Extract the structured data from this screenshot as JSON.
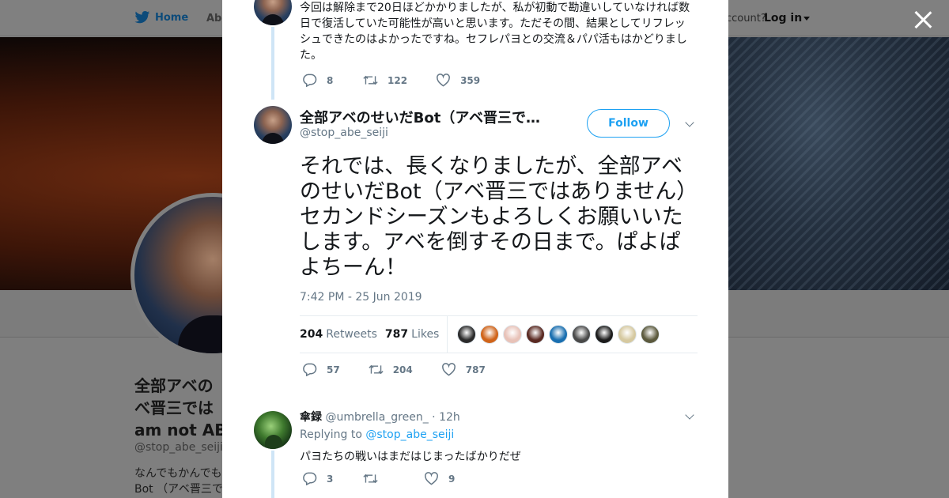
{
  "nav": {
    "home_label": "Home",
    "profile_label_partial": "Abe",
    "account_prompt": "ccount?",
    "login_label": "Log in"
  },
  "background_profile": {
    "name_line1": "全部アベの",
    "name_line2": "べ晋三では",
    "name_line3": "am not ABE",
    "handle": "@stop_abe_seiji",
    "bio_line1": "なんでもかんでも",
    "bio_line2": "Bot （アベ晋三で"
  },
  "previous_tweet": {
    "text": "今回は解除まで20日ほどかかりましたが、私が初動で勘違いしていなければ数日で復活していた可能性が高いと思います。ただその間、結果としてリフレッシュできたのはよかったですね。セフレパヨとの交流＆パパ活もはかどりました。",
    "replies": "8",
    "retweets": "122",
    "likes": "359"
  },
  "main_tweet": {
    "display_name": "全部アベのせいだBot（アベ晋三で…",
    "handle": "@stop_abe_seiji",
    "follow_label": "Follow",
    "text": "それでは、長くなりましたが、全部アベのせいだBot（アベ晋三ではありません）セカンドシーズンもよろしくお願いいたします。アベを倒すその日まで。ぱよぱよちーん！",
    "timestamp": "7:42 PM - 25 Jun 2019",
    "retweet_count": "204",
    "retweet_label": "Retweets",
    "like_count": "787",
    "like_label": "Likes",
    "replies": "57",
    "retweets": "204",
    "likes": "787",
    "liker_colors": [
      "#2b2b2b",
      "#d0641a",
      "#e8c2b8",
      "#5a2a22",
      "#1a6fb0",
      "#4a4a4a",
      "#1c1c1c",
      "#d6c9a0",
      "#5c5a3e"
    ]
  },
  "reply_tweet": {
    "display_name": "傘録",
    "handle": "@umbrella_green_",
    "time": "· 12h",
    "replying_prefix": "Replying to",
    "replying_to": "@stop_abe_seiji",
    "text": "パヨたちの戦いはまだはじまったばかりだぜ",
    "replies": "3",
    "retweets": "",
    "likes": "9"
  },
  "colors": {
    "accent": "#1da1f2",
    "muted": "#657786",
    "thread_line": "#cfe5f6"
  }
}
